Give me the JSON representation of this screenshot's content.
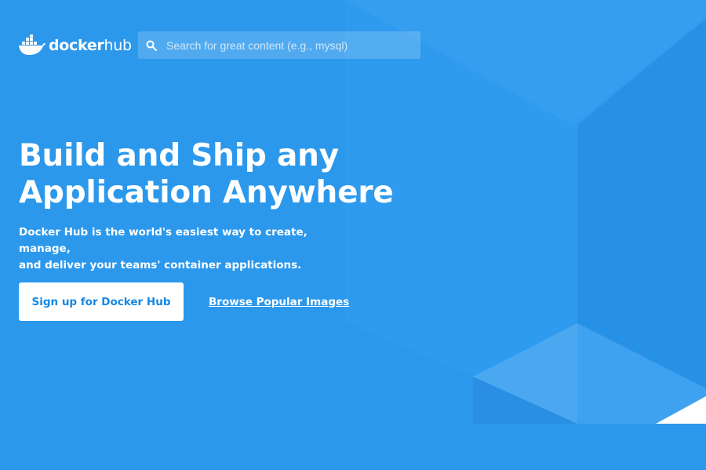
{
  "brand": {
    "name_part1": "docker",
    "name_part2": "hub",
    "logo_icon": "docker-whale-icon"
  },
  "search": {
    "icon": "search-icon",
    "placeholder": "Search for great content (e.g., mysql)",
    "value": ""
  },
  "hero": {
    "title_line1": "Build and Ship any",
    "title_line2": "Application Anywhere",
    "desc_line1": "Docker Hub is the world's easiest way to create, manage,",
    "desc_line2": "and deliver your teams' container applications."
  },
  "actions": {
    "signup_label": "Sign up for Docker Hub",
    "browse_label": "Browse Popular Images"
  },
  "colors": {
    "background": "#2b98ec",
    "button_text": "#1488e4",
    "text": "#ffffff"
  }
}
